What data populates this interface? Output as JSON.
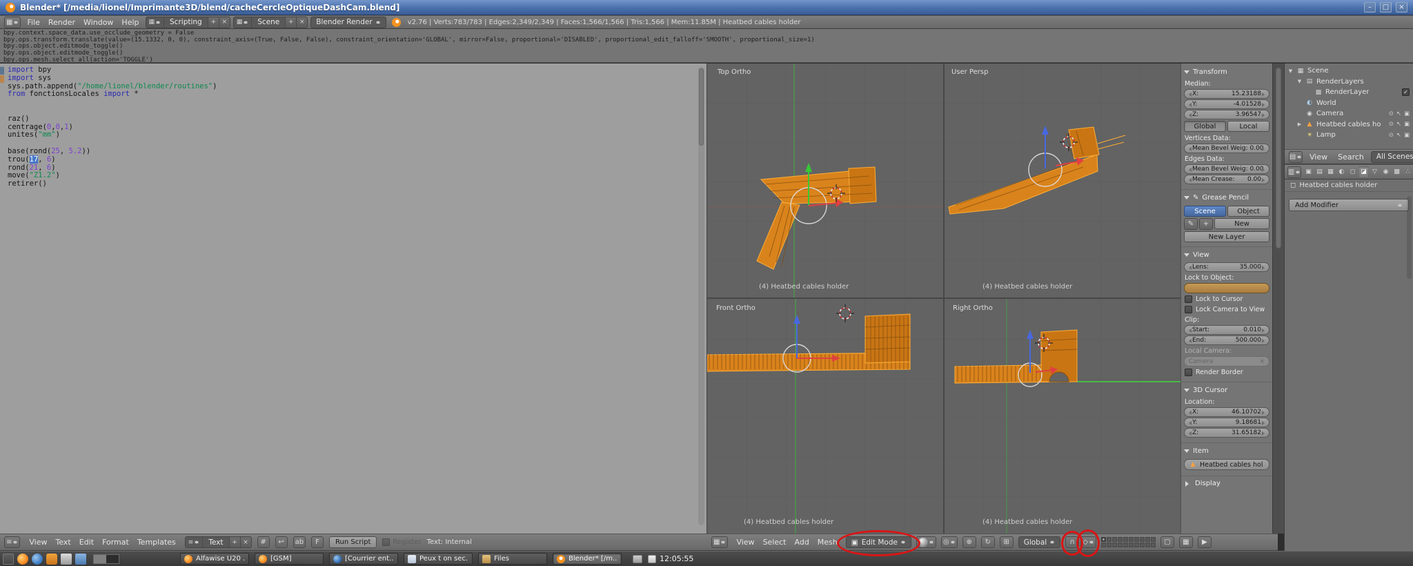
{
  "window": {
    "title": "Blender* [/media/lionel/Imprimante3D/blend/cacheCercleOptiqueDashCam.blend]",
    "controls": [
      {
        "name": "minimize",
        "glyph": "–"
      },
      {
        "name": "maximize",
        "glyph": "□"
      },
      {
        "name": "close",
        "glyph": "×"
      }
    ]
  },
  "icons": {
    "check": "✓",
    "eye": "⊙",
    "pointer": "↖",
    "render_toggle": "▣",
    "scene": "▦",
    "renderlayers": "▤",
    "renderlayer": "▩",
    "world": "◐",
    "camera": "◉",
    "mesh": "▲",
    "lamp": "☀",
    "editor_text": "≡",
    "editor_3d": "▦",
    "editor_outliner": "▤",
    "editor_props": "▥",
    "layout": "▦",
    "mode_cube": "▣",
    "pivot": "◎",
    "manip_translate": "⊕",
    "manip_rotate": "↻",
    "manip_scale": "⊞",
    "magnet": "∩",
    "snap_element": "◇",
    "lock": "▢",
    "pencil": "✎",
    "plus": "+",
    "close": "×",
    "object_cube": "◻",
    "render_image": "▦",
    "render_anim": "▶"
  },
  "menubar": {
    "menus": [
      "File",
      "Render",
      "Window",
      "Help"
    ],
    "layout_name": "Scripting",
    "scene_name": "Scene",
    "engine": "Blender Render",
    "stats": "v2.76 | Verts:783/783 | Edges:2,349/2,349 | Faces:1,566/1,566 | Tris:1,566 | Mem:11.85M | Heatbed cables holder"
  },
  "info_log": {
    "lines": [
      "bpy.context.space_data.use_occlude_geometry = False",
      "bpy.ops.transform.translate(value=(15.1332, 0, 0), constraint_axis=(True, False, False), constraint_orientation='GLOBAL', mirror=False, proportional='DISABLED', proportional_edit_falloff='SMOOTH', proportional_size=1)",
      "bpy.ops.object.editmode_toggle()",
      "bpy.ops.object.editmode_toggle()",
      "bpy.ops.mesh.select_all(action='TOGGLE')"
    ]
  },
  "text_editor": {
    "lines": [
      [
        [
          "import",
          "k"
        ],
        [
          " bpy",
          "p"
        ]
      ],
      [
        [
          "import",
          "k"
        ],
        [
          " sys",
          "p"
        ]
      ],
      [
        [
          "sys.path.append(",
          "p"
        ],
        [
          "\"/home/lionel/blender/routines\"",
          "s"
        ],
        [
          ")",
          "p"
        ]
      ],
      [
        [
          "from",
          "k"
        ],
        [
          " fonctionsLocales ",
          "p"
        ],
        [
          "import",
          "k"
        ],
        [
          " *",
          "p"
        ]
      ],
      [],
      [],
      [
        [
          "raz()",
          "p"
        ]
      ],
      [
        [
          "centrage(",
          "p"
        ],
        [
          "0",
          "n"
        ],
        [
          ",",
          "p"
        ],
        [
          "0",
          "n"
        ],
        [
          ",",
          "p"
        ],
        [
          "1",
          "n"
        ],
        [
          ")",
          "p"
        ]
      ],
      [
        [
          "unites(",
          "p"
        ],
        [
          "\"mm\"",
          "s"
        ],
        [
          ")",
          "p"
        ]
      ],
      [],
      [
        [
          "base(rond(",
          "p"
        ],
        [
          "25",
          "n"
        ],
        [
          ", ",
          "p"
        ],
        [
          "5.2",
          "n"
        ],
        [
          "))",
          "p"
        ]
      ],
      [
        [
          "trou(",
          "p"
        ],
        [
          "17",
          "sel"
        ],
        [
          ", ",
          "p"
        ],
        [
          "6",
          "n"
        ],
        [
          ")",
          "p"
        ]
      ],
      [
        [
          "rond(",
          "p"
        ],
        [
          "21",
          "n"
        ],
        [
          ", ",
          "p"
        ],
        [
          "6",
          "n"
        ],
        [
          ")",
          "p"
        ]
      ],
      [
        [
          "move(",
          "p"
        ],
        [
          "\"Z1.2\"",
          "s"
        ],
        [
          ")",
          "p"
        ]
      ],
      [
        [
          "retirer()",
          "p"
        ]
      ]
    ],
    "footer": {
      "menus": [
        "View",
        "Text",
        "Edit",
        "Format",
        "Templates"
      ],
      "datablock": "Text",
      "toggle_icons": {
        "line_numbers": "#",
        "word_wrap": "↩",
        "syntax": "ab",
        "font": "F"
      },
      "run_button": "Run Script",
      "register_label": "Register",
      "status": "Text: Internal"
    }
  },
  "viewport": {
    "quads": [
      {
        "view": "Top Ortho",
        "caption": "(4) Heatbed cables holder"
      },
      {
        "view": "User Persp",
        "caption": "(4) Heatbed cables holder"
      },
      {
        "view": "Front Ortho",
        "caption": "(4) Heatbed cables holder"
      },
      {
        "view": "Right Ortho",
        "caption": "(4) Heatbed cables holder"
      }
    ],
    "header": {
      "menus": [
        "View",
        "Select",
        "Add",
        "Mesh"
      ],
      "mode": "Edit Mode",
      "orientation": "Global",
      "layers": {
        "count": 20,
        "active": 0
      }
    }
  },
  "npanel": {
    "transform": {
      "title": "Transform",
      "median_label": "Median:",
      "median": [
        {
          "label": "X:",
          "value": "15.23188"
        },
        {
          "label": "Y:",
          "value": "-4.01528"
        },
        {
          "label": "Z:",
          "value": "3.96547"
        }
      ],
      "space_buttons": [
        "Global",
        "Local"
      ],
      "vertices_label": "Vertices Data:",
      "vert_bevel": {
        "label": "Mean Bevel Weig:",
        "value": "0.00"
      },
      "edges_label": "Edges Data:",
      "edge_bevel": {
        "label": "Mean Bevel Weig:",
        "value": "0.00"
      },
      "edge_crease": {
        "label": "Mean Crease:",
        "value": "0.00"
      }
    },
    "grease_pencil": {
      "title": "Grease Pencil",
      "tabs": [
        "Scene",
        "Object"
      ],
      "new_button": "New",
      "new_layer_button": "New Layer"
    },
    "view": {
      "title": "View",
      "lens": {
        "label": "Lens:",
        "value": "35.000"
      },
      "lock_to_object": "Lock to Object:",
      "lock_to_cursor": "Lock to Cursor",
      "lock_camera": "Lock Camera to View",
      "clip_label": "Clip:",
      "clip_start": {
        "label": "Start:",
        "value": "0.010"
      },
      "clip_end": {
        "label": "End:",
        "value": "500.000"
      },
      "local_camera_label": "Local Camera:",
      "local_camera_value": "Camera",
      "render_border": "Render Border"
    },
    "cursor3d": {
      "title": "3D Cursor",
      "location_label": "Location:",
      "location": [
        {
          "label": "X:",
          "value": "46.10702"
        },
        {
          "label": "Y:",
          "value": "9.18681"
        },
        {
          "label": "Z:",
          "value": "31.65182"
        }
      ]
    },
    "item": {
      "title": "Item",
      "name_value": "Heatbed cables hol"
    },
    "display": {
      "title": "Display"
    }
  },
  "outliner": {
    "rows": [
      {
        "label": "Scene",
        "depth": 0,
        "icon": "scene",
        "expander": "▼"
      },
      {
        "label": "RenderLayers",
        "depth": 1,
        "icon": "renderlayers",
        "expander": "▼"
      },
      {
        "label": "RenderLayer",
        "depth": 2,
        "icon": "renderlayer",
        "check": true
      },
      {
        "label": "World",
        "depth": 1,
        "icon": "world"
      },
      {
        "label": "Camera",
        "depth": 1,
        "icon": "camera",
        "toggles": true
      },
      {
        "label": "Heatbed cables ho",
        "depth": 1,
        "icon": "mesh",
        "expander": "▶",
        "toggles": true
      },
      {
        "label": "Lamp",
        "depth": 1,
        "icon": "lamp",
        "toggles": true
      }
    ],
    "header_menus": [
      "View",
      "Search"
    ],
    "display_mode": "All Scenes"
  },
  "properties": {
    "tabs": [
      {
        "name": "render",
        "glyph": "▣"
      },
      {
        "name": "render-layers",
        "glyph": "▤"
      },
      {
        "name": "scene",
        "glyph": "▦"
      },
      {
        "name": "world",
        "glyph": "◐"
      },
      {
        "name": "object",
        "glyph": "◻"
      },
      {
        "name": "modifiers",
        "glyph": "◪",
        "active": true
      },
      {
        "name": "data",
        "glyph": "▽"
      },
      {
        "name": "material",
        "glyph": "◉"
      },
      {
        "name": "texture",
        "glyph": "▩"
      },
      {
        "name": "particles",
        "glyph": "∴"
      },
      {
        "name": "physics",
        "glyph": "◎"
      }
    ],
    "breadcrumb": "Heatbed cables holder",
    "add_modifier_button": "Add Modifier"
  },
  "taskbar": {
    "launchers": [
      {
        "name": "menu"
      },
      {
        "name": "firefox"
      },
      {
        "name": "mail"
      },
      {
        "name": "package"
      },
      {
        "name": "files"
      },
      {
        "name": "editor"
      }
    ],
    "windows": [
      {
        "label": "Alfawise U20 ...",
        "icon": "firefox"
      },
      {
        "label": "[GSM]",
        "icon": "firefox"
      },
      {
        "label": "[Courrier ent...",
        "icon": "thunderbird"
      },
      {
        "label": "Peux t on sec...",
        "icon": "document"
      },
      {
        "label": "Files",
        "icon": "files"
      },
      {
        "label": "Blender* [/m...",
        "icon": "blender",
        "active": true
      }
    ],
    "clock": "12:05:55"
  },
  "colors": {
    "accent_orange": "#f5921d",
    "select_blue": "#4678c8",
    "viewport_bg": "#636363",
    "annotation_red": "#da1515"
  }
}
